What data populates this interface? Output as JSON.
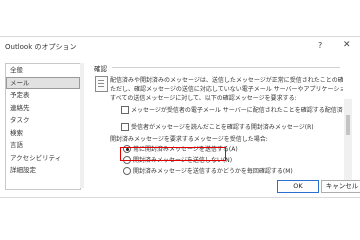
{
  "window": {
    "title": "Outlook のオプション",
    "help_glyph": "?",
    "close_glyph": "✕"
  },
  "sidebar": {
    "items": [
      "全般",
      "メール",
      "予定表",
      "連絡先",
      "タスク",
      "検索",
      "言語",
      "アクセシビリティ",
      "詳細設定"
    ]
  },
  "content": {
    "group_title": "確認",
    "description_1": "配信済みや開封済みのメッセージは、送信したメッセージが正常に受信されたことの確認になります。",
    "description_2": "ただし、確認メッセージの送信に対応していない電子メール サーバーやアプリケーションもあります。",
    "all_sent_label": "すべての送信メッセージに対して、以下の確認メッセージを要求する:",
    "option_delivery": "メッセージが受信者の電子メール サーバーに配信されたことを確認する配信済みメッセージ",
    "option_read": "受信者がメッセージを読んだことを確認する開封済みメッセージ(R)",
    "read_request_label": "開封済みメッセージを要求するメッセージを受信した場合:",
    "radios": [
      "常に開封済みメッセージを送信する(A)",
      "開封済みメッセージを送信しない(N)",
      "開封済みメッセージを送信するかどうかを毎回確認する(M)"
    ]
  },
  "buttons": {
    "ok": "OK",
    "cancel": "キャンセル"
  }
}
